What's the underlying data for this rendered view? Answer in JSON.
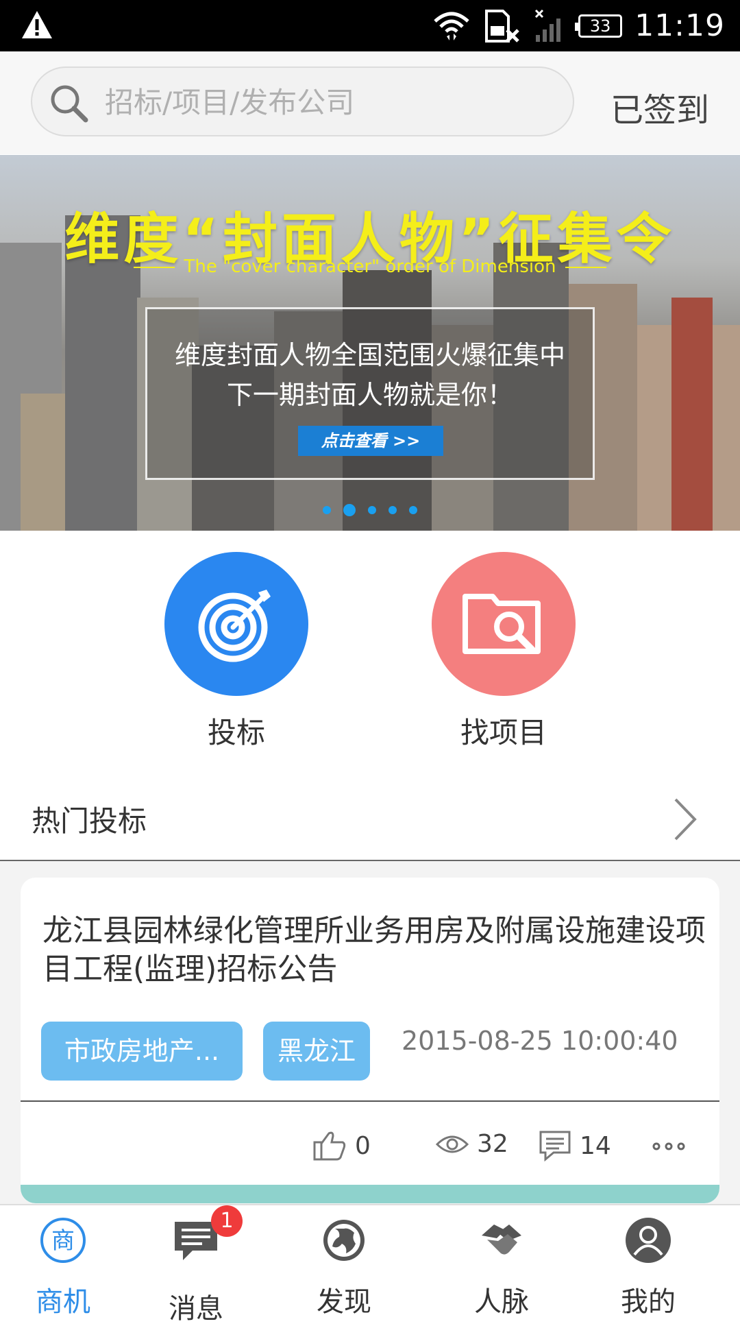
{
  "status_bar": {
    "time": "11:19",
    "battery": "33",
    "icons": [
      "warning-icon",
      "wifi-icon",
      "sim-off-icon",
      "signal-icon",
      "battery-icon"
    ]
  },
  "header": {
    "search_placeholder": "招标/项目/发布公司",
    "checkin_label": "已签到"
  },
  "banner": {
    "title": "维度“封面人物”征集令",
    "subtitle": "The  \"cover character\"  order of Dimension",
    "line1": "维度封面人物全国范围火爆征集中",
    "line2": "下一期封面人物就是你！",
    "button_label": "点击查看 >>",
    "slide_count": 5,
    "active_slide": 2
  },
  "actions": [
    {
      "label": "投标",
      "icon": "target-icon",
      "color": "#2a87f0"
    },
    {
      "label": "找项目",
      "icon": "folder-search-icon",
      "color": "#f47f7f"
    }
  ],
  "hot_section": {
    "title": "热门投标"
  },
  "card": {
    "title": "龙江县园林绿化管理所业务用房及附属设施建设项目工程(监理)招标公告",
    "tag1": "市政房地产...",
    "tag2": "黑龙江",
    "date": "2015-08-25 10:00:40",
    "likes": "0",
    "views": "32",
    "comments": "14"
  },
  "nav": {
    "items": [
      {
        "label": "商机",
        "icon": "business-icon",
        "active": true
      },
      {
        "label": "消息",
        "icon": "message-icon",
        "badge": "1"
      },
      {
        "label": "发现",
        "icon": "globe-icon"
      },
      {
        "label": "人脉",
        "icon": "handshake-icon"
      },
      {
        "label": "我的",
        "icon": "profile-icon"
      }
    ]
  },
  "colors": {
    "accent": "#2e8de8",
    "tag": "#6cbcf0",
    "banner_title": "#f4ee1a",
    "badge": "#ef3b3b"
  }
}
